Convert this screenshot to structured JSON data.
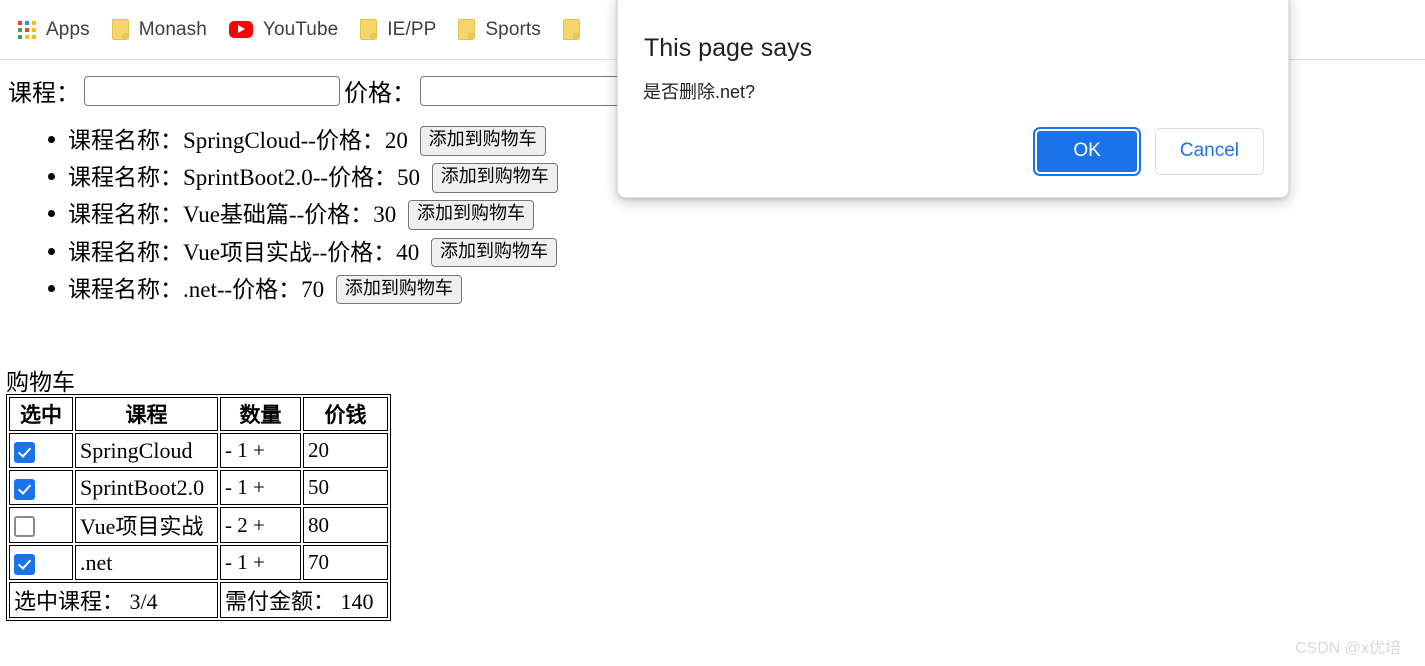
{
  "bookmarks_bar": {
    "items": [
      {
        "label": "Apps",
        "icon": "apps-grid-icon"
      },
      {
        "label": "Monash",
        "icon": "folder-icon"
      },
      {
        "label": "YouTube",
        "icon": "youtube-icon"
      },
      {
        "label": "IE/PP",
        "icon": "folder-icon"
      },
      {
        "label": "Sports",
        "icon": "folder-icon"
      },
      {
        "label": "",
        "icon": "folder-icon"
      }
    ]
  },
  "form": {
    "course_label": "课程：",
    "course_value": "",
    "course_placeholder": "",
    "price_label": "价格：",
    "price_value": "",
    "price_placeholder": ""
  },
  "course_list": {
    "name_prefix": "课程名称：",
    "price_prefix": "--价格：",
    "add_button_label": "添加到购物车",
    "items": [
      {
        "name": "SpringCloud",
        "price": "20"
      },
      {
        "name": "SprintBoot2.0",
        "price": "50"
      },
      {
        "name": "Vue基础篇",
        "price": "30"
      },
      {
        "name": "Vue项目实战",
        "price": "40"
      },
      {
        "name": ".net",
        "price": "70"
      }
    ]
  },
  "cart": {
    "title": "购物车",
    "headers": [
      "选中",
      "课程",
      "数量",
      "价钱"
    ],
    "rows": [
      {
        "checked": true,
        "name": "SpringCloud",
        "qty": "- 1 +",
        "price": "20"
      },
      {
        "checked": true,
        "name": "SprintBoot2.0",
        "qty": "- 1 +",
        "price": "50"
      },
      {
        "checked": false,
        "name": "Vue项目实战",
        "qty": "- 2 +",
        "price": "80"
      },
      {
        "checked": true,
        "name": ".net",
        "qty": "- 1 +",
        "price": "70"
      }
    ],
    "footer": {
      "selected_label": "选中课程： 3/4",
      "total_label": "需付金额： 140"
    }
  },
  "dialog": {
    "title": "This page says",
    "message": "是否删除.net?",
    "ok_label": "OK",
    "cancel_label": "Cancel",
    "accent_color": "#1a73e8"
  },
  "watermark": {
    "text": "CSDN @x优培"
  }
}
